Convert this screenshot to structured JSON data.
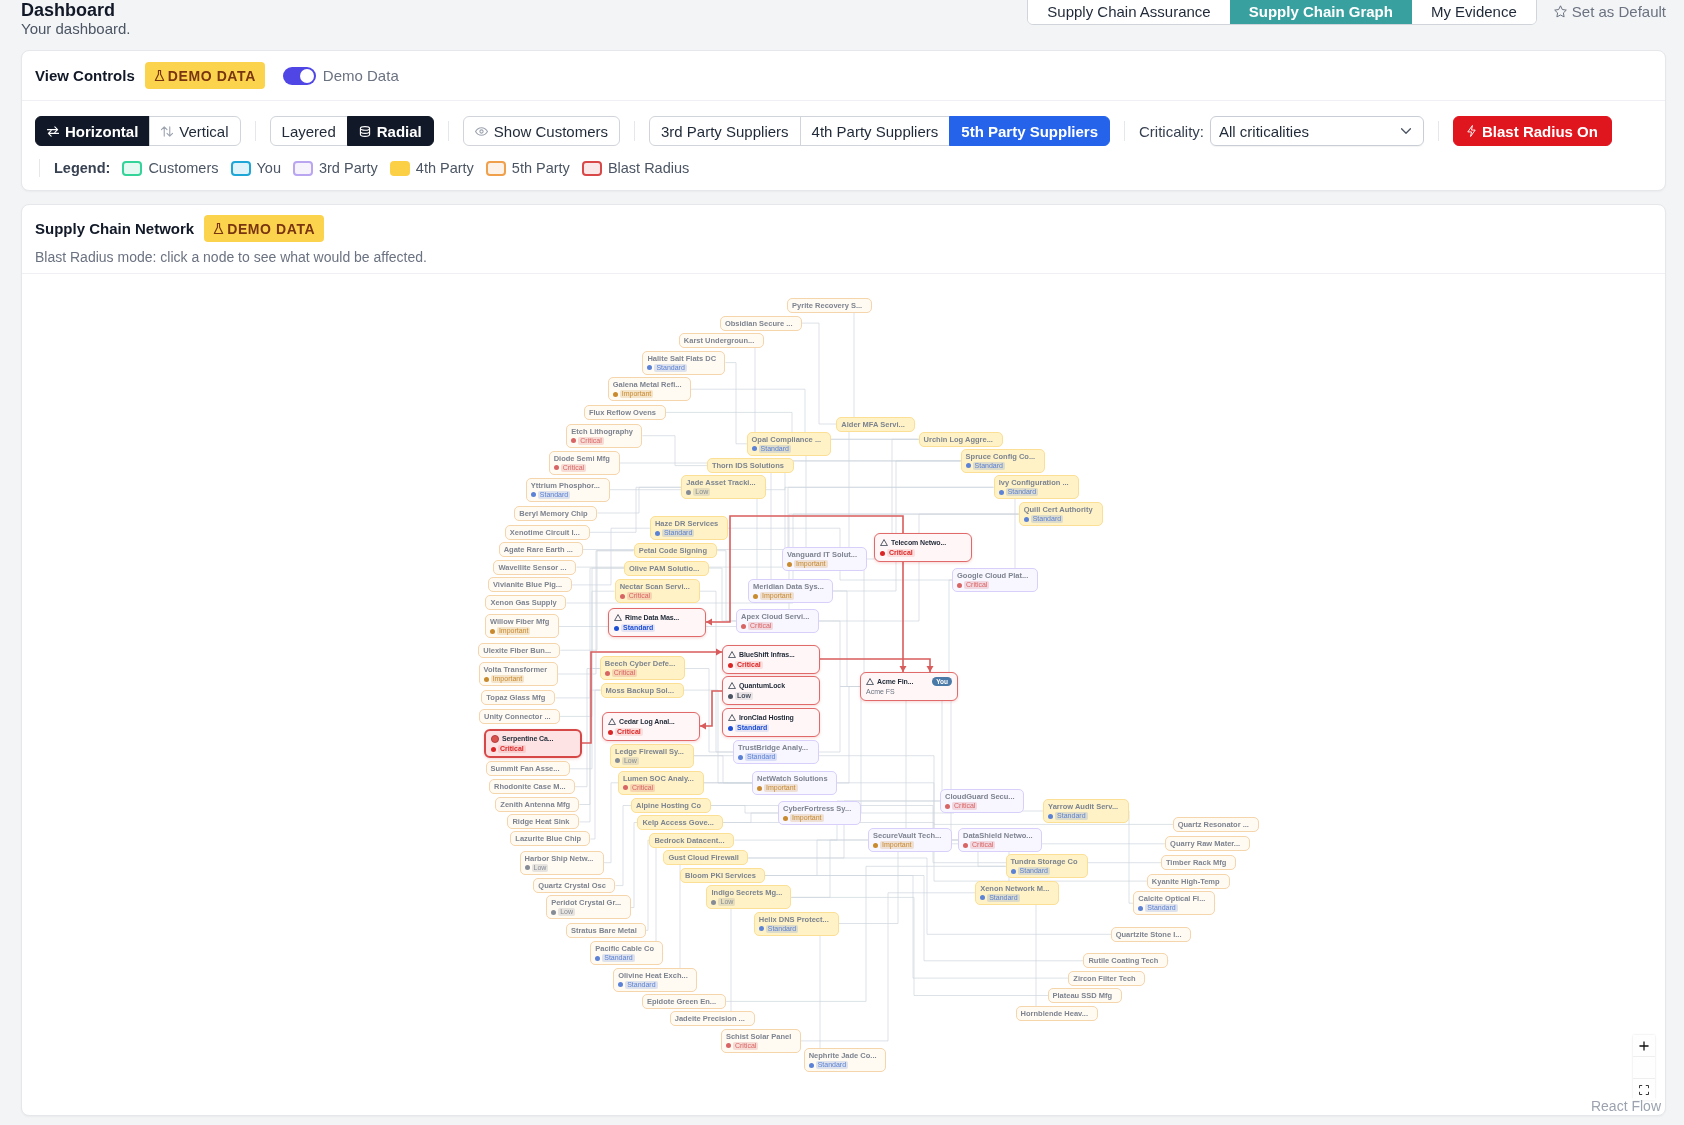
{
  "header": {
    "title": "Dashboard",
    "subtitle": "Your dashboard."
  },
  "view_tabs": [
    {
      "label": "Supply Chain Assurance",
      "selected": false
    },
    {
      "label": "Supply Chain Graph",
      "selected": true
    },
    {
      "label": "My Evidence",
      "selected": false
    }
  ],
  "set_default": "Set as Default",
  "view_controls": {
    "title": "View Controls",
    "badge": "DEMO DATA",
    "demo_toggle": {
      "on": true,
      "label": "Demo Data"
    },
    "orientation": [
      {
        "label": "Horizontal",
        "selected": true
      },
      {
        "label": "Vertical",
        "selected": false
      }
    ],
    "layout": [
      {
        "label": "Layered",
        "selected": false
      },
      {
        "label": "Radial",
        "selected": true
      }
    ],
    "show_customers": {
      "label": "Show Customers",
      "selected": false
    },
    "supplier_tiers": [
      {
        "label": "3rd Party Suppliers",
        "selected": false
      },
      {
        "label": "4th Party Suppliers",
        "selected": false
      },
      {
        "label": "5th Party Suppliers",
        "selected": true
      }
    ],
    "criticality": {
      "label": "Criticality:",
      "value": "All criticalities"
    },
    "blast_radius": {
      "label": "Blast Radius On",
      "on": true
    },
    "legend": {
      "label": "Legend:",
      "items": [
        {
          "label": "Customers",
          "color": "#34d399",
          "filled": false
        },
        {
          "label": "You",
          "color": "#1ea7d6",
          "filled": false
        },
        {
          "label": "3rd Party",
          "color": "#b9a5f0",
          "filled": false
        },
        {
          "label": "4th Party",
          "color": "#fbd045",
          "filled": true
        },
        {
          "label": "5th Party",
          "color": "#f0a04b",
          "filled": false
        },
        {
          "label": "Blast Radius",
          "color": "#d94848",
          "filled": false
        }
      ]
    }
  },
  "network": {
    "title": "Supply Chain Network",
    "badge": "DEMO DATA",
    "subtitle": "Blast Radius mode: click a node to see what would be affected.",
    "tiers": [
      {
        "kind": "fifth_party",
        "nodes": [
          {
            "name": "Pyrite Recovery S..."
          },
          {
            "name": "Obsidian Secure ..."
          },
          {
            "name": "Karst Undergroun..."
          },
          {
            "name": "Halite Salt Flats DC",
            "tag": "Standard",
            "color": "#5b82d6"
          },
          {
            "name": "Galena Metal Refi...",
            "tag": "Important",
            "color": "#c98a2e"
          },
          {
            "name": "Flux Reflow Ovens"
          },
          {
            "name": "Etch Lithography",
            "tag": "Critical",
            "color": "#d96464"
          },
          {
            "name": "Diode Semi Mfg",
            "tag": "Critical",
            "color": "#d96464"
          },
          {
            "name": "Yttrium Phosphor...",
            "tag": "Standard",
            "color": "#5b82d6"
          },
          {
            "name": "Beryl Memory Chip"
          },
          {
            "name": "Xenotime Circuit I..."
          },
          {
            "name": "Agate Rare Earth ..."
          },
          {
            "name": "Wavellite Sensor ..."
          },
          {
            "name": "Vivianite Blue Pig..."
          },
          {
            "name": "Xenon Gas Supply"
          },
          {
            "name": "Willow Fiber Mfg",
            "tag": "Important",
            "color": "#c98a2e"
          },
          {
            "name": "Ulexite Fiber Bun..."
          },
          {
            "name": "Volta Transformer",
            "tag": "Important",
            "color": "#c98a2e"
          },
          {
            "name": "Topaz Glass Mfg"
          },
          {
            "name": "Unity Connector ..."
          },
          {
            "name": "Summit Fan Asse..."
          },
          {
            "name": "Rhodonite Case M..."
          },
          {
            "name": "Zenith Antenna Mfg"
          },
          {
            "name": "Ridge Heat Sink"
          },
          {
            "name": "Lazurite Blue Chip"
          },
          {
            "name": "Quartz Resonator ..."
          },
          {
            "name": "Harbor Ship Netw...",
            "tag": "Low",
            "color": "#858c96"
          },
          {
            "name": "Quarry Raw Mater..."
          },
          {
            "name": "Timber Rack Mfg"
          },
          {
            "name": "Quartz Crystal Osc"
          },
          {
            "name": "Kyanite High-Temp"
          },
          {
            "name": "Peridot Crystal Gr...",
            "tag": "Low",
            "color": "#858c96"
          },
          {
            "name": "Calcite Optical Fl...",
            "tag": "Standard",
            "color": "#5b82d6"
          },
          {
            "name": "Stratus Bare Metal"
          },
          {
            "name": "Pacific Cable Co",
            "tag": "Standard",
            "color": "#5b82d6"
          },
          {
            "name": "Quartzite Stone I..."
          },
          {
            "name": "Olivine Heat Exch...",
            "tag": "Standard",
            "color": "#5b82d6"
          },
          {
            "name": "Rutile Coating Tech"
          },
          {
            "name": "Zircon Filter Tech"
          },
          {
            "name": "Epidote Green En..."
          },
          {
            "name": "Plateau SSD Mfg"
          },
          {
            "name": "Jadeite Precision ..."
          },
          {
            "name": "Hornblende Heav..."
          },
          {
            "name": "Schist Solar Panel",
            "tag": "Critical",
            "color": "#d96464"
          },
          {
            "name": "Nephrite Jade Co...",
            "tag": "Standard",
            "color": "#5b82d6"
          }
        ]
      },
      {
        "kind": "fourth_party",
        "nodes": [
          {
            "name": "Alder MFA Servi..."
          },
          {
            "name": "Opal Compliance ...",
            "tag": "Standard",
            "color": "#5b82d6"
          },
          {
            "name": "Urchin Log Aggre..."
          },
          {
            "name": "Thorn IDS Solutions"
          },
          {
            "name": "Spruce Config Co...",
            "tag": "Standard",
            "color": "#5b82d6"
          },
          {
            "name": "Jade Asset Tracki...",
            "tag": "Low",
            "color": "#858c96"
          },
          {
            "name": "Ivy Configuration ...",
            "tag": "Standard",
            "color": "#5b82d6"
          },
          {
            "name": "Haze DR Services",
            "tag": "Standard",
            "color": "#5b82d6"
          },
          {
            "name": "Quill Cert Authority",
            "tag": "Standard",
            "color": "#5b82d6"
          },
          {
            "name": "Petal Code Signing"
          },
          {
            "name": "Olive PAM Solutio..."
          },
          {
            "name": "Nectar Scan Servi...",
            "tag": "Critical",
            "color": "#d96464"
          },
          {
            "name": "Beech Cyber Defe...",
            "tag": "Critical",
            "color": "#d96464"
          },
          {
            "name": "Moss Backup Sol..."
          },
          {
            "name": "Ledge Firewall Sy...",
            "tag": "Low",
            "color": "#858c96"
          },
          {
            "name": "Lumen SOC Analy...",
            "tag": "Critical",
            "color": "#d96464"
          },
          {
            "name": "Alpine Hosting Co"
          },
          {
            "name": "Kelp Access Gove..."
          },
          {
            "name": "Yarrow Audit Serv...",
            "tag": "Standard",
            "color": "#5b82d6"
          },
          {
            "name": "Bedrock Datacent..."
          },
          {
            "name": "Gust Cloud Firewall"
          },
          {
            "name": "Bloom PKI Services"
          },
          {
            "name": "Tundra Storage Co",
            "tag": "Standard",
            "color": "#5b82d6"
          },
          {
            "name": "Indigo Secrets Mg...",
            "tag": "Low",
            "color": "#858c96"
          },
          {
            "name": "Xenon Network M...",
            "tag": "Standard",
            "color": "#5b82d6"
          },
          {
            "name": "Helix DNS Protect...",
            "tag": "Standard",
            "color": "#5b82d6"
          }
        ]
      },
      {
        "kind": "third_party",
        "nodes": [
          {
            "name": "Vanguard IT Solut...",
            "tag": "Important",
            "color": "#c98a2e"
          },
          {
            "name": "Meridian Data Sys...",
            "tag": "Important",
            "color": "#c98a2e"
          },
          {
            "name": "Google Cloud Plat...",
            "tag": "Critical",
            "color": "#d96464"
          },
          {
            "name": "Apex Cloud Servi...",
            "tag": "Critical",
            "color": "#d96464"
          },
          {
            "name": "TrustBridge Analy...",
            "tag": "Standard",
            "color": "#5b82d6"
          },
          {
            "name": "NetWatch Solutions",
            "tag": "Important",
            "color": "#c98a2e"
          },
          {
            "name": "CyberFortress Sy...",
            "tag": "Important",
            "color": "#c98a2e"
          },
          {
            "name": "CloudGuard Secu...",
            "tag": "Critical",
            "color": "#d96464"
          },
          {
            "name": "SecureVault Tech...",
            "tag": "Important",
            "color": "#c98a2e"
          },
          {
            "name": "DataShield Netwo...",
            "tag": "Critical",
            "color": "#d96464"
          }
        ]
      }
    ],
    "blast_nodes": [
      {
        "name": "Telecom Netwo...",
        "tag": "Critical",
        "color": "#dc2626",
        "selected": false
      },
      {
        "name": "Rime Data Mas...",
        "tag": "Standard",
        "color": "#1d4ed8",
        "selected": false
      },
      {
        "name": "BlueShift Infras...",
        "tag": "Critical",
        "color": "#dc2626",
        "selected": false
      },
      {
        "name": "QuantumLock",
        "tag": "Low",
        "color": "#4b5563",
        "selected": false
      },
      {
        "name": "Acme Fin...",
        "badge": "You",
        "subtitle": "Acme FS",
        "selected": false
      },
      {
        "name": "Serpentine Ca...",
        "tag": "Critical",
        "color": "#dc2626",
        "selected": true
      },
      {
        "name": "Cedar Log Anal...",
        "tag": "Critical",
        "color": "#dc2626",
        "selected": false
      },
      {
        "name": "IronClad Hosting",
        "tag": "Standard",
        "color": "#1d4ed8",
        "selected": false
      }
    ],
    "attribution": "React Flow"
  }
}
